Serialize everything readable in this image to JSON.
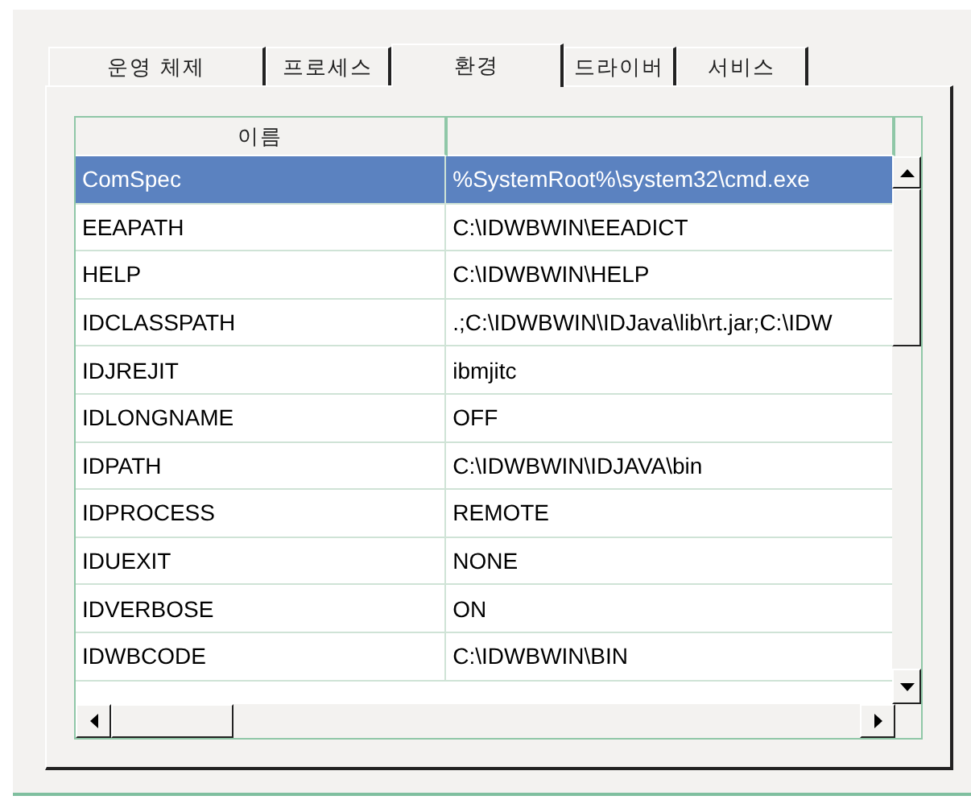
{
  "tabs": [
    {
      "label": "운영 체제",
      "selected": false
    },
    {
      "label": "프로세스",
      "selected": false
    },
    {
      "label": "환경",
      "selected": true
    },
    {
      "label": "드라이버",
      "selected": false
    },
    {
      "label": "서비스",
      "selected": false
    }
  ],
  "list": {
    "columns": [
      "이름"
    ],
    "rows": [
      {
        "name": "ComSpec",
        "value": "%SystemRoot%\\system32\\cmd.exe",
        "selected": true
      },
      {
        "name": "EEAPATH",
        "value": "C:\\IDWBWIN\\EEADICT",
        "selected": false
      },
      {
        "name": "HELP",
        "value": "C:\\IDWBWIN\\HELP",
        "selected": false
      },
      {
        "name": "IDCLASSPATH",
        "value": ".;C:\\IDWBWIN\\IDJava\\lib\\rt.jar;C:\\IDW",
        "selected": false
      },
      {
        "name": "IDJREJIT",
        "value": "ibmjitc",
        "selected": false
      },
      {
        "name": "IDLONGNAME",
        "value": "OFF",
        "selected": false
      },
      {
        "name": "IDPATH",
        "value": "C:\\IDWBWIN\\IDJAVA\\bin",
        "selected": false
      },
      {
        "name": "IDPROCESS",
        "value": "REMOTE",
        "selected": false
      },
      {
        "name": "IDUEXIT",
        "value": "NONE",
        "selected": false
      },
      {
        "name": "IDVERBOSE",
        "value": "ON",
        "selected": false
      },
      {
        "name": "IDWBCODE",
        "value": "C:\\IDWBWIN\\BIN",
        "selected": false
      }
    ]
  }
}
